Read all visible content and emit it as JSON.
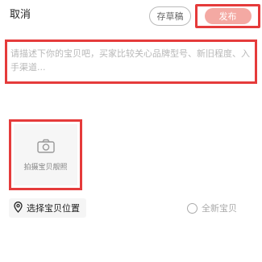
{
  "header": {
    "cancel_label": "取消",
    "draft_label": "存草稿",
    "publish_label": "发布"
  },
  "description": {
    "placeholder": "请描述下你的宝贝吧，买家比较关心品牌型号、新旧程度、入手渠道..."
  },
  "photo": {
    "label": "拍摄宝贝靓照",
    "icon": "camera-icon"
  },
  "location": {
    "label": "选择宝贝位置",
    "icon": "location-pin-icon"
  },
  "condition": {
    "label": "全新宝贝",
    "checked": false
  },
  "colors": {
    "highlight": "#e53b3b",
    "publish_bg": "#f4a9a3"
  }
}
